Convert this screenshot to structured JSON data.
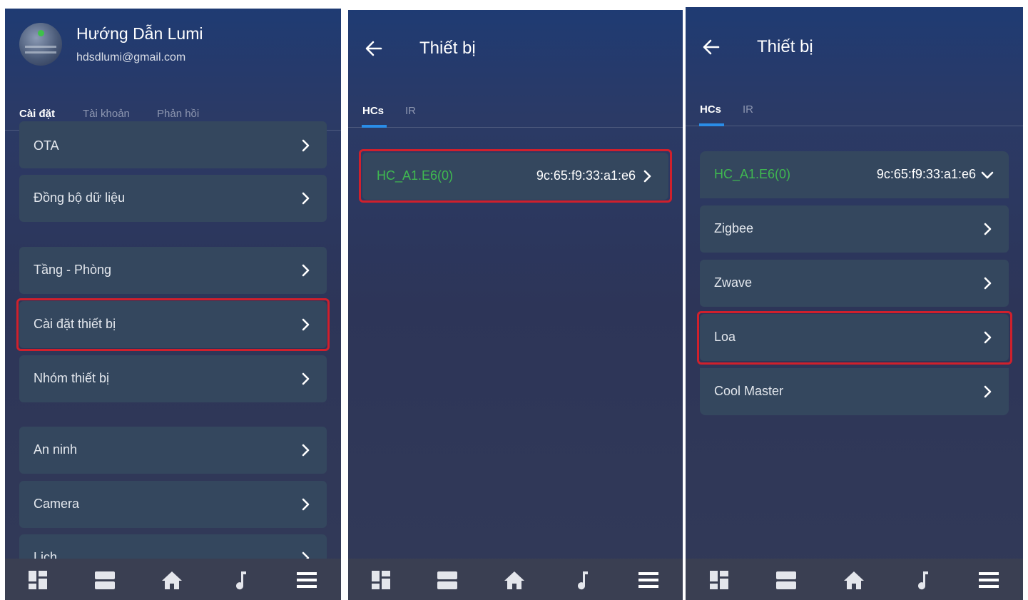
{
  "panel1": {
    "profile": {
      "name": "Hướng Dẫn Lumi",
      "email": "hdsdlumi@gmail.com"
    },
    "tabs": [
      "Cài đặt",
      "Tài khoản",
      "Phản hồi"
    ],
    "items": [
      "OTA",
      "Đồng bộ dữ liệu",
      "Tầng - Phòng",
      "Cài đặt thiết bị",
      "Nhóm thiết bị",
      "An ninh",
      "Camera",
      "Lịch"
    ]
  },
  "panel2": {
    "title": "Thiết bị",
    "tabs": [
      "HCs",
      "IR"
    ],
    "hc": {
      "name": "HC_A1.E6(0)",
      "mac": "9c:65:f9:33:a1:e6"
    }
  },
  "panel3": {
    "title": "Thiết bị",
    "tabs": [
      "HCs",
      "IR"
    ],
    "hc": {
      "name": "HC_A1.E6(0)",
      "mac": "9c:65:f9:33:a1:e6"
    },
    "items": [
      "Zigbee",
      "Zwave",
      "Loa",
      "Cool Master"
    ]
  },
  "colors": {
    "accent": "#2a8de8",
    "highlight": "#d0202c",
    "hc_green": "#3fb950",
    "row_bg": "#34475e"
  },
  "icons": [
    "dashboard-icon",
    "devices-icon",
    "home-icon",
    "music-icon",
    "menu-icon"
  ]
}
